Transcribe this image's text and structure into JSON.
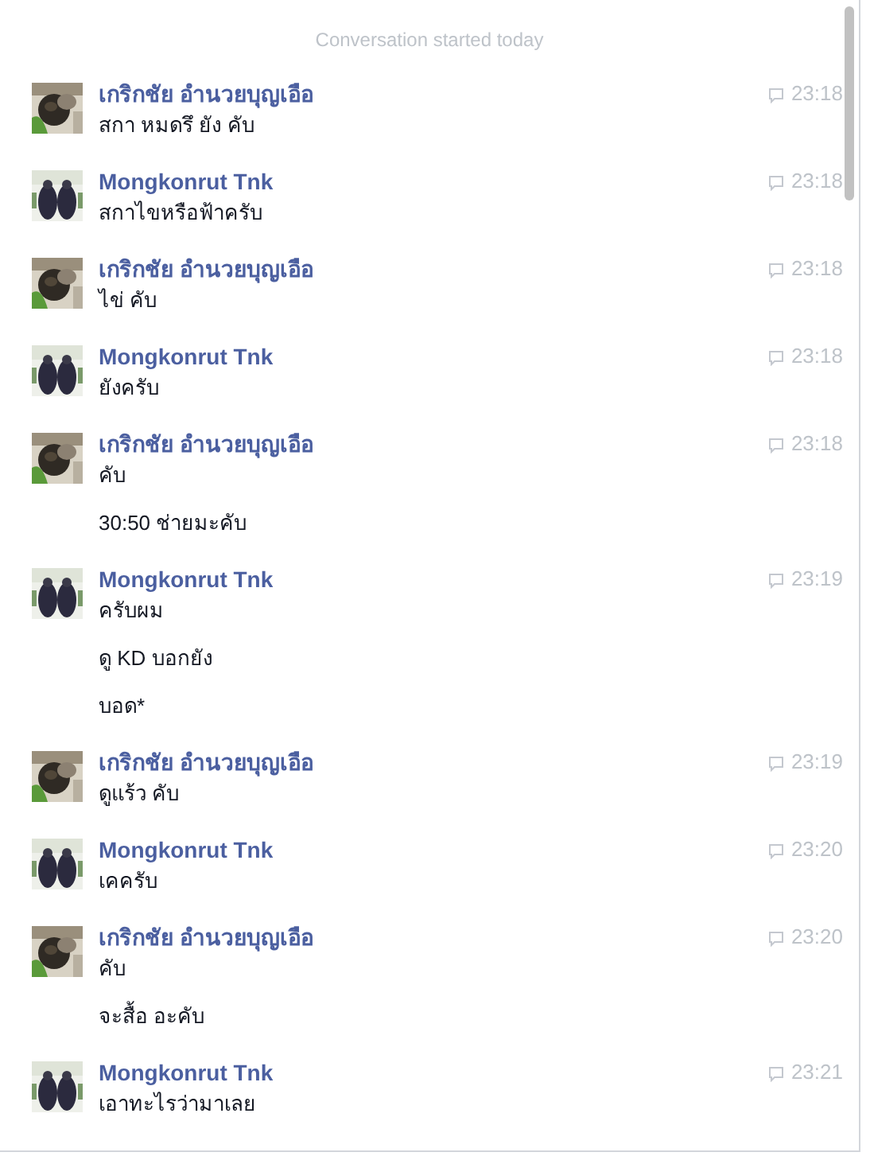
{
  "header": "Conversation started today",
  "groups": [
    {
      "sender": "เกริกชัย อำนวยบุญเอือ",
      "time": "23:18",
      "messages": [
        "สกา หมดรึ ยัง คับ"
      ]
    },
    {
      "sender": "Mongkonrut Tnk",
      "time": "23:18",
      "messages": [
        "สกาไขหรือฟ้าครับ"
      ]
    },
    {
      "sender": "เกริกชัย อำนวยบุญเอือ",
      "time": "23:18",
      "messages": [
        "ไข่ คับ"
      ]
    },
    {
      "sender": "Mongkonrut Tnk",
      "time": "23:18",
      "messages": [
        "ยังครับ"
      ]
    },
    {
      "sender": "เกริกชัย อำนวยบุญเอือ",
      "time": "23:18",
      "messages": [
        "คับ",
        "30:50 ช่ายมะคับ"
      ]
    },
    {
      "sender": "Mongkonrut Tnk",
      "time": "23:19",
      "messages": [
        "ครับผม",
        "ดู KD บอกยัง",
        "บอด*"
      ]
    },
    {
      "sender": "เกริกชัย อำนวยบุญเอือ",
      "time": "23:19",
      "messages": [
        "ดูแร้ว คับ"
      ]
    },
    {
      "sender": "Mongkonrut Tnk",
      "time": "23:20",
      "messages": [
        "เคครับ"
      ]
    },
    {
      "sender": "เกริกชัย อำนวยบุญเอือ",
      "time": "23:20",
      "messages": [
        "คับ",
        "จะสื้อ อะคับ"
      ]
    },
    {
      "sender": "Mongkonrut Tnk",
      "time": "23:21",
      "messages": [
        "เอาทะไรว่ามาเลย"
      ]
    }
  ]
}
